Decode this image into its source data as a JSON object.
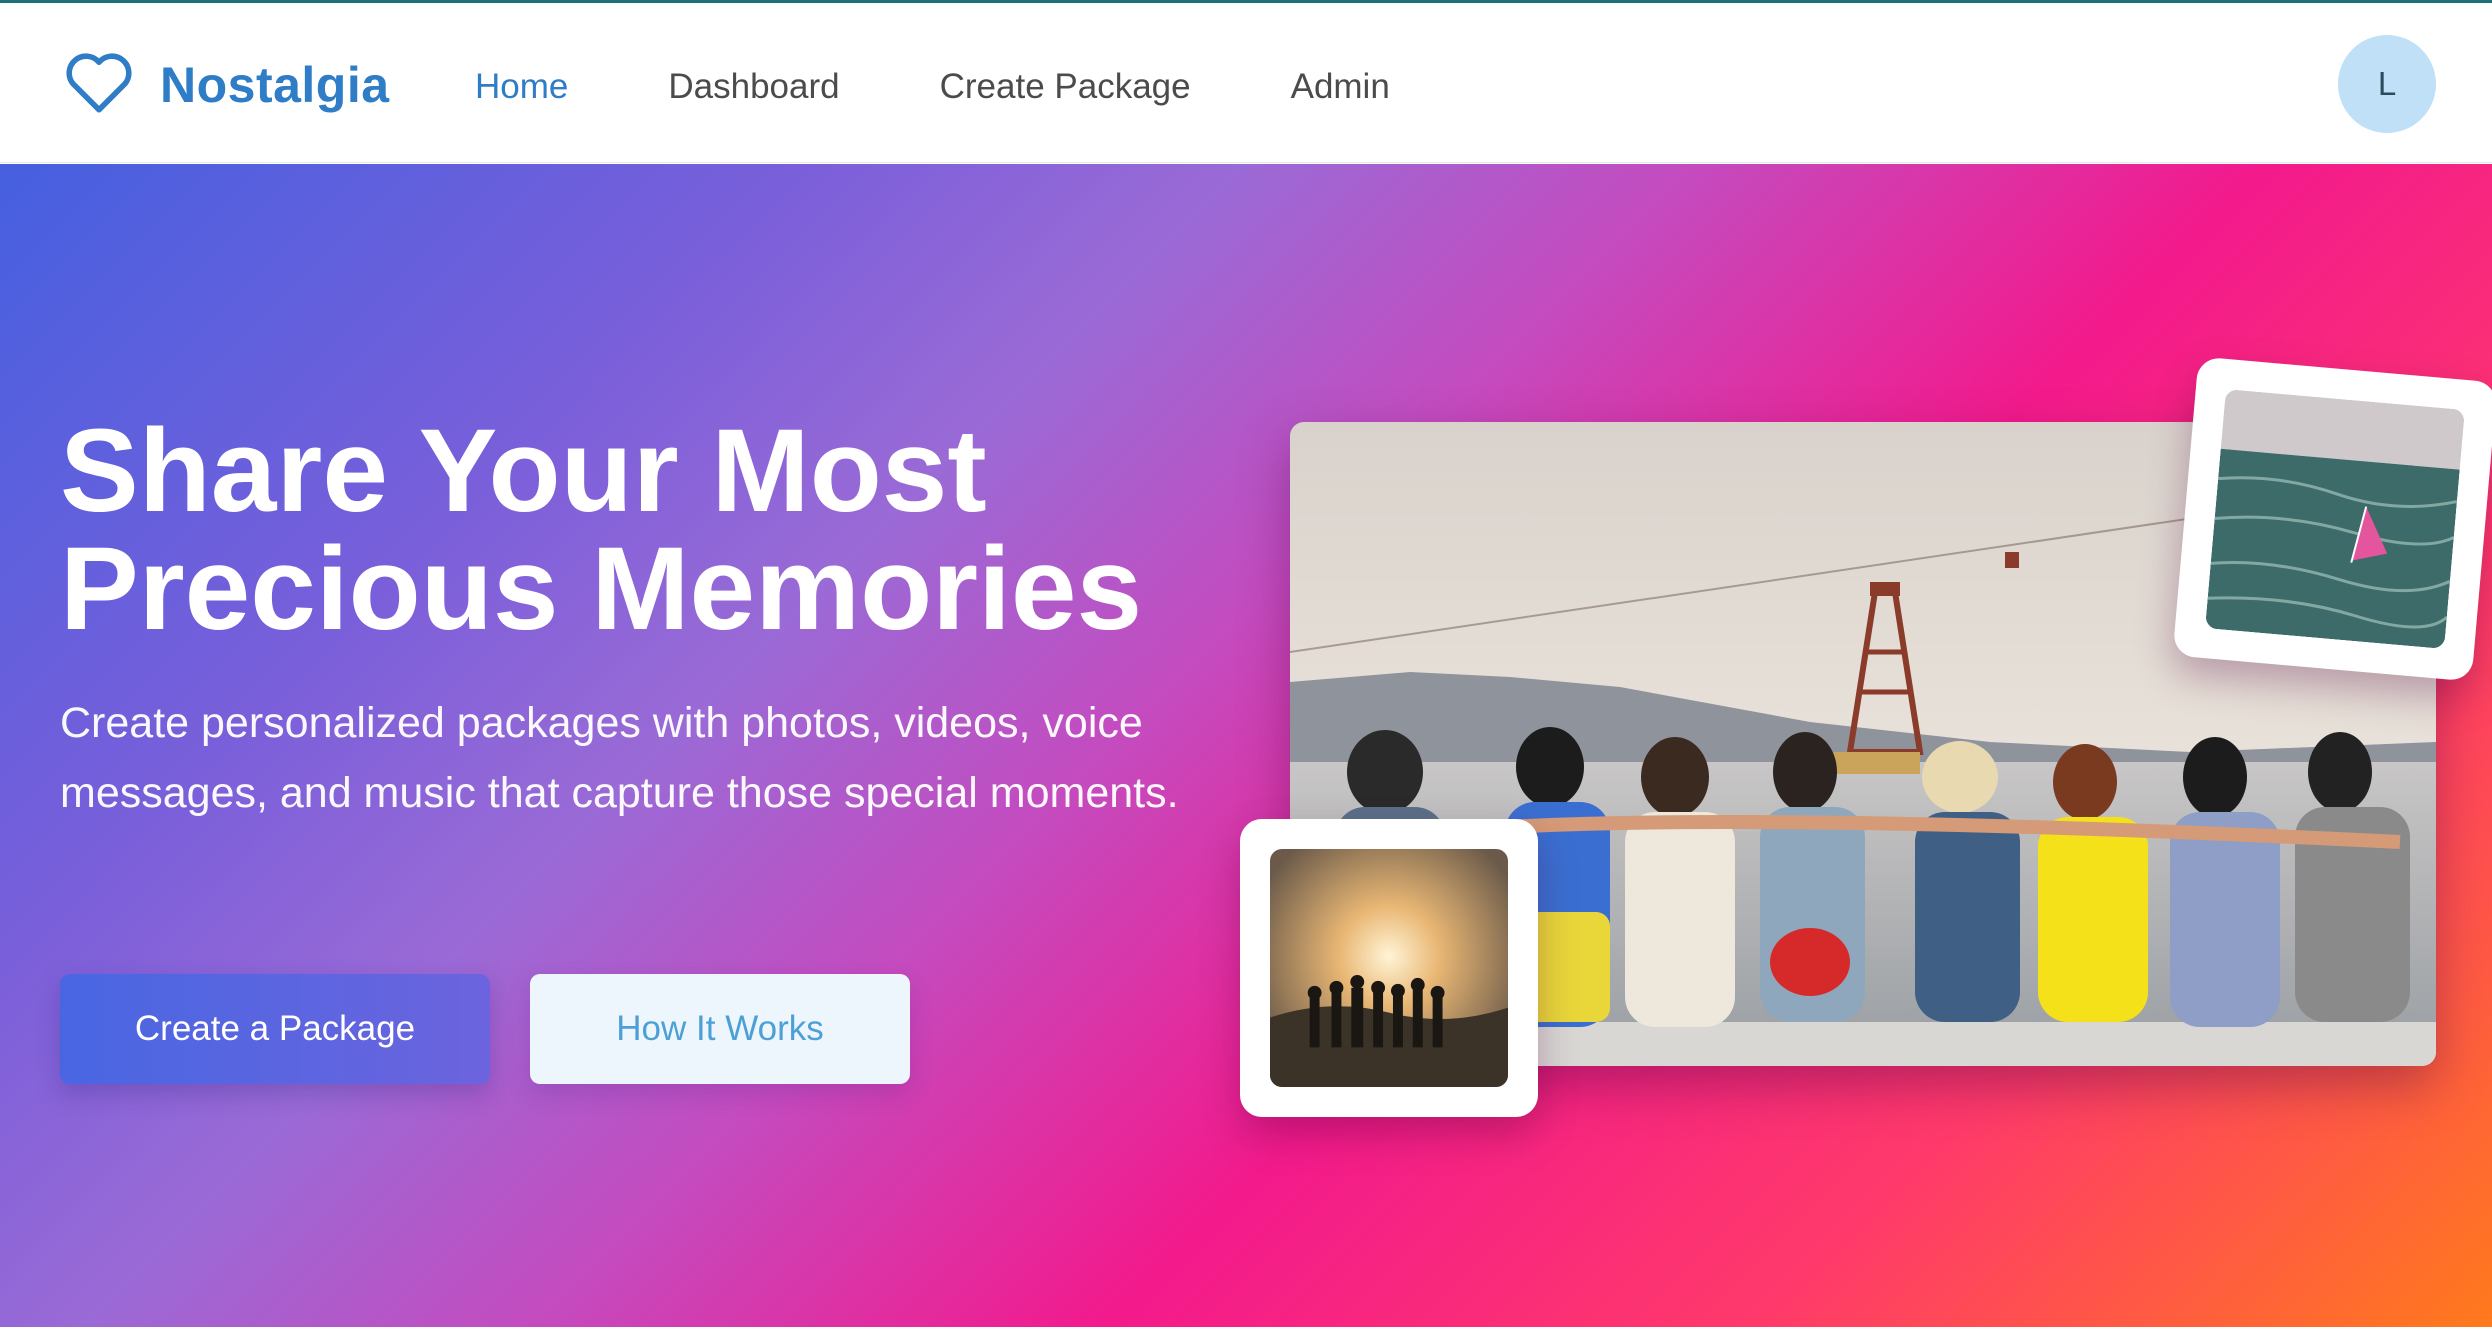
{
  "brand": {
    "name": "Nostalgia",
    "icon": "heart-icon",
    "color": "#2f7cc7"
  },
  "nav": {
    "items": [
      {
        "label": "Home",
        "active": true
      },
      {
        "label": "Dashboard",
        "active": false
      },
      {
        "label": "Create Package",
        "active": false
      },
      {
        "label": "Admin",
        "active": false
      }
    ]
  },
  "user": {
    "avatar_initial": "L"
  },
  "hero": {
    "headline_line1": "Share Your Most",
    "headline_line2": "Precious Memories",
    "subtitle": "Create personalized packages with photos, videos, voice messages, and music that capture those special moments.",
    "primary_button": "Create a Package",
    "secondary_button": "How It Works",
    "gradient_colors": [
      "#4560e0",
      "#9a6ad6",
      "#f31a8c",
      "#ff7a1c"
    ]
  }
}
